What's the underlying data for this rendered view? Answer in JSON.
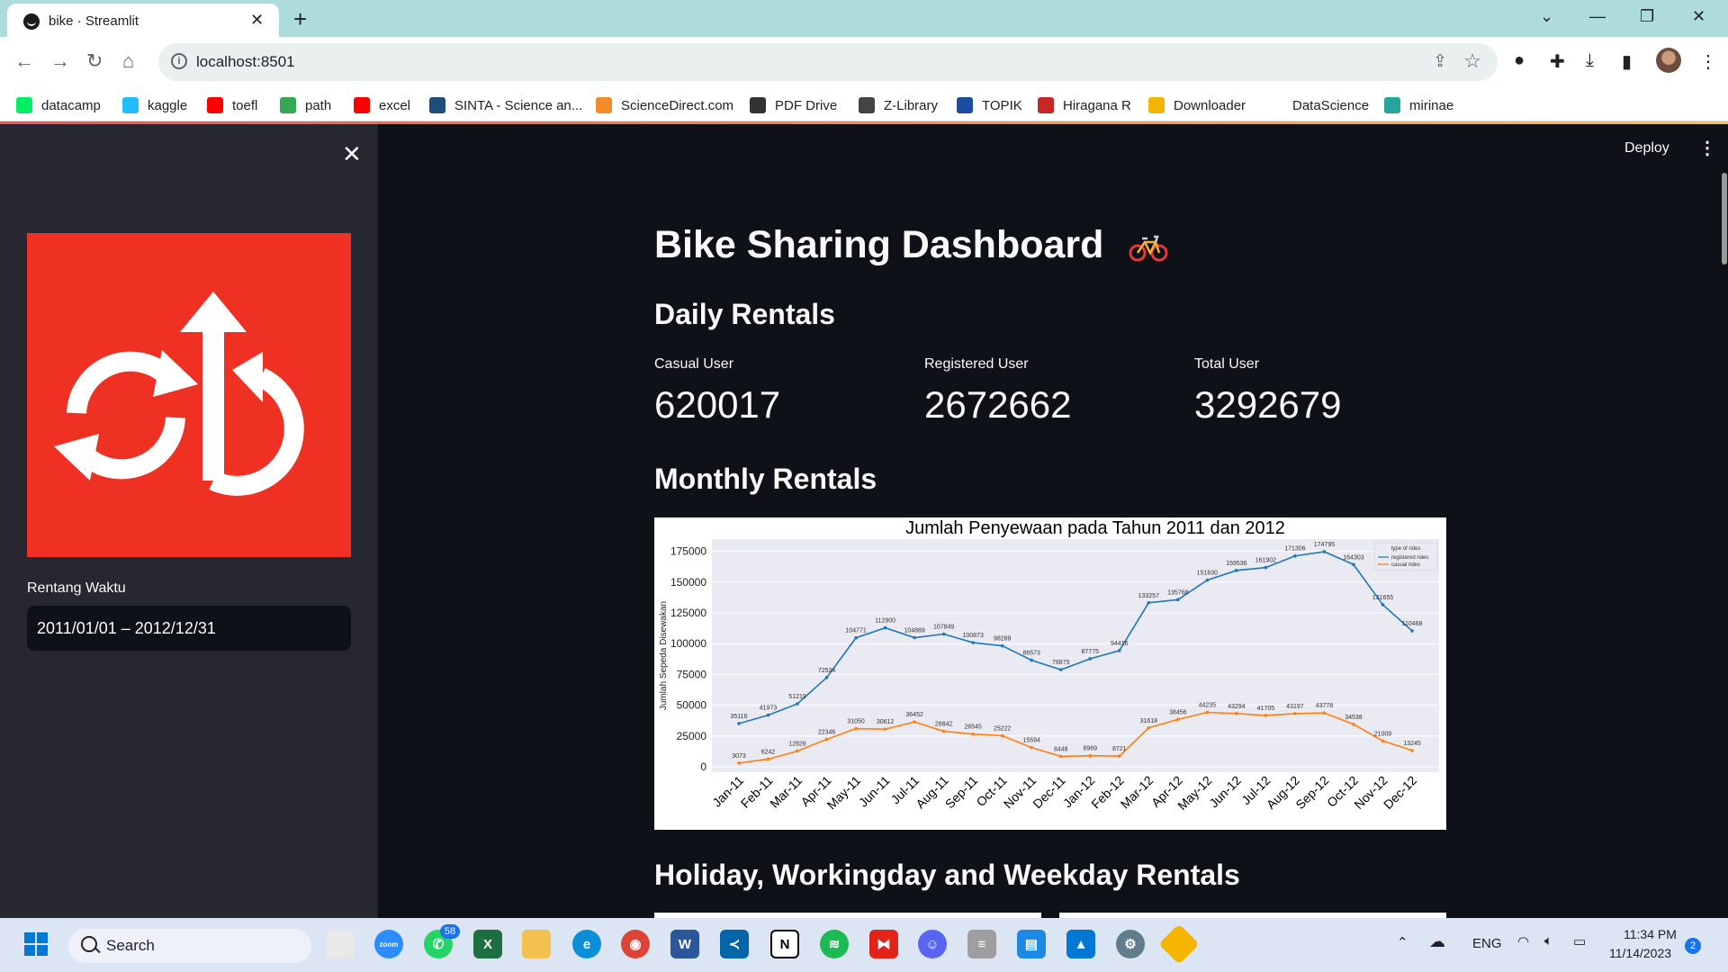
{
  "browser": {
    "tab_title": "bike · Streamlit",
    "tab_close": "✕",
    "new_tab": "+",
    "url": "localhost:8501",
    "window_controls": {
      "collapse": "⌄",
      "minimize": "—",
      "restore": "❐",
      "close": "✕"
    }
  },
  "bookmarks": [
    {
      "label": "datacamp",
      "icon": "datacamp-icon",
      "color": "#03ef62"
    },
    {
      "label": "kaggle",
      "icon": "kaggle-icon",
      "color": "#20beff"
    },
    {
      "label": "toefl",
      "icon": "youtube-icon",
      "color": "#ff0000"
    },
    {
      "label": "path",
      "icon": "path-icon",
      "color": "#34a853"
    },
    {
      "label": "excel",
      "icon": "youtube-icon",
      "color": "#ff0000"
    },
    {
      "label": "SINTA - Science an...",
      "icon": "sinta-icon",
      "color": "#1f4e79"
    },
    {
      "label": "ScienceDirect.com",
      "icon": "sciencedirect-icon",
      "color": "#f28c28"
    },
    {
      "label": "PDF Drive",
      "icon": "pdfdrive-icon",
      "color": "#333333"
    },
    {
      "label": "Z-Library",
      "icon": "zlibrary-icon",
      "color": "#444444"
    },
    {
      "label": "TOPIK",
      "icon": "topik-icon",
      "color": "#1a4fa0"
    },
    {
      "label": "Hiragana R",
      "icon": "hiragana-icon",
      "color": "#c62828"
    },
    {
      "label": "Downloader",
      "icon": "downloader-icon",
      "color": "#f4b400"
    },
    {
      "label": "DataScience",
      "icon": "blank-icon",
      "color": "#ffffff"
    },
    {
      "label": "mirinae",
      "icon": "mirinae-icon",
      "color": "#26a69a"
    }
  ],
  "sidebar": {
    "close": "✕",
    "date_label": "Rentang Waktu",
    "date_value": "2011/01/01 – 2012/12/31"
  },
  "header": {
    "deploy": "Deploy",
    "menu": "⋮"
  },
  "main": {
    "title": "Bike Sharing Dashboard",
    "daily_heading": "Daily Rentals",
    "metrics": [
      {
        "label": "Casual User",
        "value": "620017"
      },
      {
        "label": "Registered User",
        "value": "2672662"
      },
      {
        "label": "Total User",
        "value": "3292679"
      }
    ],
    "monthly_heading": "Monthly Rentals",
    "holiday_heading": "Holiday, Workingday and Weekday Rentals"
  },
  "chart_data": {
    "type": "line",
    "title": "Jumlah Penyewaan pada Tahun 2011 dan 2012",
    "xlabel": "",
    "ylabel": "Jumlah Sepeda Disewakan",
    "ylim": [
      0,
      185000
    ],
    "yticks": [
      0,
      25000,
      50000,
      75000,
      100000,
      125000,
      150000,
      175000
    ],
    "grid": true,
    "legend_title": "type of rides",
    "legend_position": "top-right",
    "categories": [
      "Jan-11",
      "Feb-11",
      "Mar-11",
      "Apr-11",
      "May-11",
      "Jun-11",
      "Jul-11",
      "Aug-11",
      "Sep-11",
      "Oct-11",
      "Nov-11",
      "Dec-11",
      "Jan-12",
      "Feb-12",
      "Mar-12",
      "Apr-12",
      "May-12",
      "Jun-12",
      "Jul-12",
      "Aug-12",
      "Sep-12",
      "Oct-12",
      "Nov-12",
      "Dec-12"
    ],
    "series": [
      {
        "name": "registered rides",
        "color": "#1f77b4",
        "values": [
          35116,
          41973,
          51219,
          72524,
          104771,
          112900,
          104889,
          107849,
          100873,
          98289,
          86573,
          78875,
          87775,
          94416,
          133257,
          135768,
          151630,
          159536,
          161902,
          171306,
          174795,
          164303,
          131655,
          110468
        ]
      },
      {
        "name": "casual rides",
        "color": "#ff7f0e",
        "values": [
          3073,
          6242,
          12826,
          22346,
          31050,
          30612,
          36452,
          28842,
          26545,
          25222,
          15594,
          8448,
          8969,
          8721,
          31618,
          38456,
          44235,
          43294,
          41705,
          43197,
          43778,
          34538,
          21009,
          13245
        ]
      }
    ]
  },
  "taskbar": {
    "search": "Search",
    "whatsapp_badge": "58",
    "lang": "ENG",
    "time": "11:34 PM",
    "date": "11/14/2023",
    "notif_badge": "2"
  }
}
